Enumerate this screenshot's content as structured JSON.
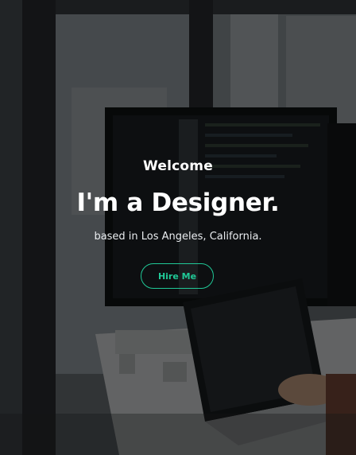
{
  "hero": {
    "greeting": "Welcome",
    "headline": "I'm a Designer.",
    "location": "based in Los Angeles, California.",
    "cta_label": "Hire Me"
  },
  "colors": {
    "accent": "#20c997",
    "text": "#ffffff",
    "overlay": "rgba(0,0,0,0.55)"
  }
}
